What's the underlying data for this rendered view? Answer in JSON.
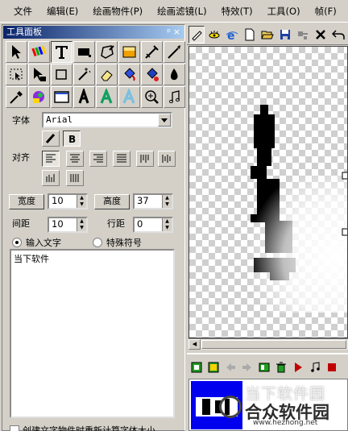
{
  "menu": [
    "文件",
    "编辑(E)",
    "绘画物件(P)",
    "绘画滤镜(L)",
    "特效(T)",
    "工具(O)",
    "帧(F)"
  ],
  "panel": {
    "title": "工具面板",
    "pin": "ᵖ",
    "close": "×",
    "font_label": "字体",
    "font_value": "Arial",
    "align_label": "对齐",
    "width_btn": "宽度",
    "width_value": "10",
    "height_btn": "高度",
    "height_value": "37",
    "spacing_label": "间距",
    "spacing_value": "10",
    "linespacing_label": "行距",
    "linespacing_value": "0",
    "radio_input": "输入文字",
    "radio_special": "特殊符号",
    "text_content": "当下软件",
    "checkbox_label": "创建文字物件时重新计算字体大小"
  },
  "watermark": {
    "line1": "当下软件园",
    "line2": "合众软件园",
    "line3": "www.hezhong.net"
  },
  "colors": {
    "title_start": "#0a246a",
    "title_end": "#a6caf0",
    "thumb_blue": "#0000ee"
  }
}
